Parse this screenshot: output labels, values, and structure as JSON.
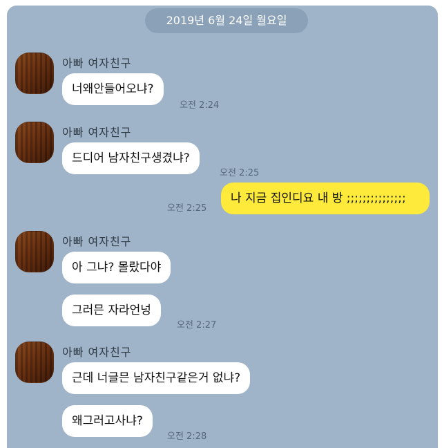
{
  "date_divider": "2019년 6월 24일 월요일",
  "messages": [
    {
      "sender": "아빠 여자친구",
      "text": "너왜안들어오냐?",
      "time": "오전 2:24"
    },
    {
      "sender": "아빠 여자친구",
      "text": "드디어 남자친구생겼냐?",
      "time": "오전 2:25"
    },
    {
      "sender": "me",
      "text": "나 지금 집인디요 내 방 ;;;;;;;;;;;;;;;",
      "time": "오전 2:25"
    },
    {
      "sender": "아빠 여자친구",
      "text": "아 그냐? 몰랐다야",
      "time": ""
    },
    {
      "sender": "아빠 여자친구",
      "text": "그러믄 자라언넝",
      "time": "오전 2:27"
    },
    {
      "sender": "아빠 여자친구",
      "text": "근데 너글믄 남자친구같은거 없냐?",
      "time": ""
    },
    {
      "sender": "아빠 여자친구",
      "text": "왜그러고사냐?",
      "time": "오전 2:28"
    }
  ],
  "colors": {
    "chat_background": "#9fb4c9",
    "incoming_bubble": "#ffffff",
    "outgoing_bubble": "#fdea3a"
  }
}
